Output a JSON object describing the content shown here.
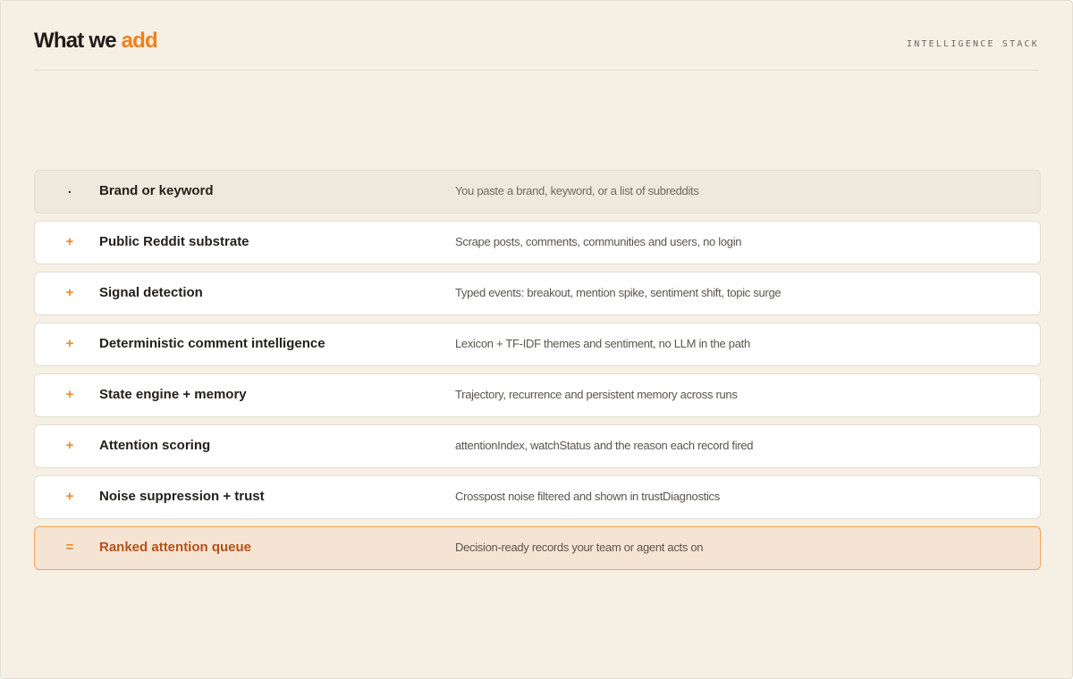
{
  "header": {
    "title_prefix": "What we ",
    "title_accent": "add",
    "eyebrow": "INTELLIGENCE STACK"
  },
  "colors": {
    "accent": "#f0801e",
    "background": "#f5efe4",
    "output_highlight": "#f5e4d3",
    "output_border": "#f0a55a",
    "output_label": "#b4521a"
  },
  "stack": [
    {
      "kind": "input",
      "symbol": ".",
      "label": "Brand or keyword",
      "description": "You paste a brand, keyword, or a list of subreddits"
    },
    {
      "kind": "layer",
      "symbol": "+",
      "label": "Public Reddit substrate",
      "description": "Scrape posts, comments, communities and users, no login"
    },
    {
      "kind": "layer",
      "symbol": "+",
      "label": "Signal detection",
      "description": "Typed events: breakout, mention spike, sentiment shift, topic surge"
    },
    {
      "kind": "layer",
      "symbol": "+",
      "label": "Deterministic comment intelligence",
      "description": "Lexicon + TF-IDF themes and sentiment, no LLM in the path"
    },
    {
      "kind": "layer",
      "symbol": "+",
      "label": "State engine + memory",
      "description": "Trajectory, recurrence and persistent memory across runs"
    },
    {
      "kind": "layer",
      "symbol": "+",
      "label": "Attention scoring",
      "description": "attentionIndex, watchStatus and the reason each record fired"
    },
    {
      "kind": "layer",
      "symbol": "+",
      "label": "Noise suppression + trust",
      "description": "Crosspost noise filtered and shown in trustDiagnostics"
    },
    {
      "kind": "output",
      "symbol": "=",
      "label": "Ranked attention queue",
      "description": "Decision-ready records your team or agent acts on"
    }
  ]
}
